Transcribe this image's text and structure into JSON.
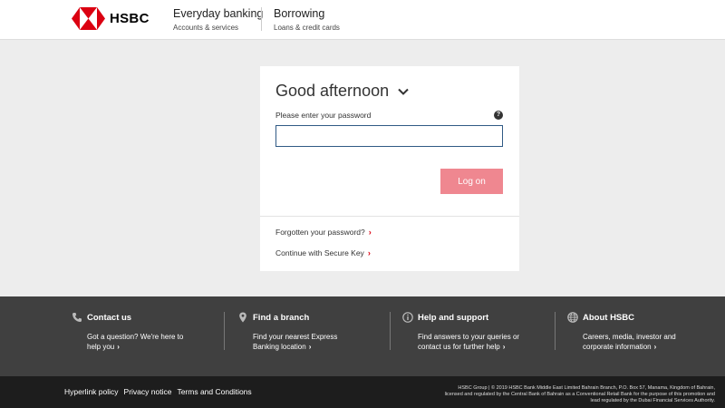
{
  "header": {
    "logo_text": "HSBC",
    "nav": [
      {
        "title": "Everyday banking",
        "subtitle": "Accounts & services"
      },
      {
        "title": "Borrowing",
        "subtitle": "Loans & credit cards"
      }
    ]
  },
  "login": {
    "greeting": "Good afternoon",
    "password_label": "Please enter your password",
    "help_icon": "?",
    "password_value": "",
    "logon_label": "Log on",
    "links": [
      {
        "label": "Forgotten your password?",
        "arrow": "›"
      },
      {
        "label": "Continue with Secure Key",
        "arrow": "›"
      }
    ]
  },
  "footer": {
    "columns": [
      {
        "icon": "phone-icon",
        "title": "Contact us",
        "line1": "Got a question? We're here to",
        "line2": "help you",
        "arrow": "›"
      },
      {
        "icon": "location-pin-icon",
        "title": "Find a branch",
        "line1": "Find your nearest Express",
        "line2": "Banking location",
        "arrow": "›"
      },
      {
        "icon": "info-icon",
        "title": "Help and support",
        "line1": "Find answers to your queries or",
        "line2": "contact us for further help",
        "arrow": "›"
      },
      {
        "icon": "globe-icon",
        "title": "About HSBC",
        "line1": "Careers, media, investor and",
        "line2": "corporate information",
        "arrow": "›"
      }
    ],
    "legal_links": [
      "Hyperlink policy",
      "Privacy notice",
      "Terms and Conditions"
    ],
    "legal_text": "HSBC Group | © 2019 HSBC Bank Middle East Limited Bahrain Branch, P.O. Box 57, Manama, Kingdom of Bahrain, licensed and regulated by the Central Bank of Bahrain as a Conventional Retail Bank for the purpose of this promotion and lead regulated by the Dubai Financial Services Authority."
  },
  "colors": {
    "brand_red": "#db0011",
    "logon_button": "#ef8790",
    "footer_dark": "#404040",
    "footer_darker": "#1d1d1d",
    "page_bg": "#ededed"
  }
}
